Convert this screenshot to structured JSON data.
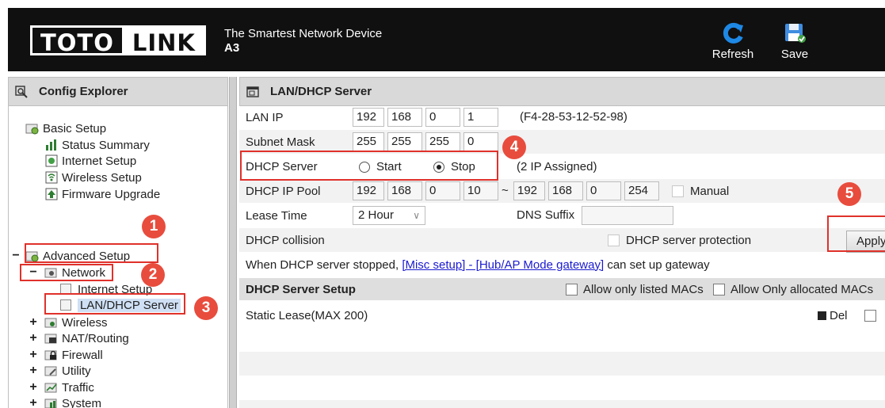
{
  "header": {
    "logo_left": "TOTO",
    "logo_right": "LINK",
    "tagline": "The Smartest Network Device",
    "model": "A3",
    "refresh_label": "Refresh",
    "save_label": "Save"
  },
  "sidebar": {
    "title": "Config Explorer",
    "basic_setup": "Basic Setup",
    "basic_items": [
      "Status Summary",
      "Internet Setup",
      "Wireless Setup",
      "Firmware Upgrade"
    ],
    "advanced_setup": "Advanced Setup",
    "network": "Network",
    "network_items": [
      "Internet Setup",
      "LAN/DHCP Server"
    ],
    "other_groups": [
      "Wireless",
      "NAT/Routing",
      "Firewall",
      "Utility",
      "Traffic",
      "System"
    ],
    "toggle_expanded": "−",
    "toggle_collapsed": "+"
  },
  "panel": {
    "title": "LAN/DHCP Server",
    "lan_ip_label": "LAN IP",
    "lan_ip": [
      "192",
      "168",
      "0",
      "1"
    ],
    "mac": "(F4-28-53-12-52-98)",
    "subnet_label": "Subnet Mask",
    "subnet": [
      "255",
      "255",
      "255",
      "0"
    ],
    "dhcp_server_label": "DHCP Server",
    "dhcp_start": "Start",
    "dhcp_stop": "Stop",
    "assigned": "(2 IP Assigned)",
    "pool_label": "DHCP IP Pool",
    "pool_start": [
      "192",
      "168",
      "0",
      "10"
    ],
    "pool_sep": "~",
    "pool_end": [
      "192",
      "168",
      "0",
      "254"
    ],
    "manual_label": "Manual",
    "lease_label": "Lease Time",
    "lease_value": "2 Hour",
    "dns_suffix_label": "DNS Suffix",
    "dns_suffix_value": "",
    "collision_label": "DHCP collision",
    "protection_label": "DHCP server protection",
    "apply_label": "Apply",
    "notice_prefix": "When DHCP server stopped, ",
    "notice_link": "[Misc setup] - [Hub/AP Mode gateway]",
    "notice_suffix": " can set up gateway",
    "section_title": "DHCP Server Setup",
    "allow_listed": "Allow only listed MACs",
    "allow_allocated": "Allow Only allocated MACs",
    "static_lease": "Static Lease(MAX 200)",
    "del_label": "Del"
  },
  "annotations": [
    "1",
    "2",
    "3",
    "4",
    "5"
  ],
  "colors": {
    "annotation": "#e0312b",
    "header_bg": "#101010",
    "link": "#1a1ad0"
  }
}
